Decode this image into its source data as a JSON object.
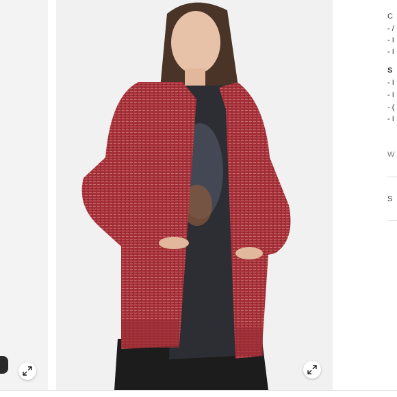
{
  "gallery": {
    "main_image_alt": "Model wearing a red marled oversized knit cardigan over a graphic tee and ripped black jeans",
    "expand_icon": "expand-arrows-icon"
  },
  "colors": {
    "cardigan": "#a8313a",
    "cardigan_highlight": "#c46a6a",
    "background": "#f1f1f1"
  },
  "side_panel": {
    "lines": [
      "C",
      "- /",
      "- I",
      "- I",
      "S",
      "- I",
      "- I",
      "- (",
      "- I",
      "W",
      "S"
    ]
  }
}
